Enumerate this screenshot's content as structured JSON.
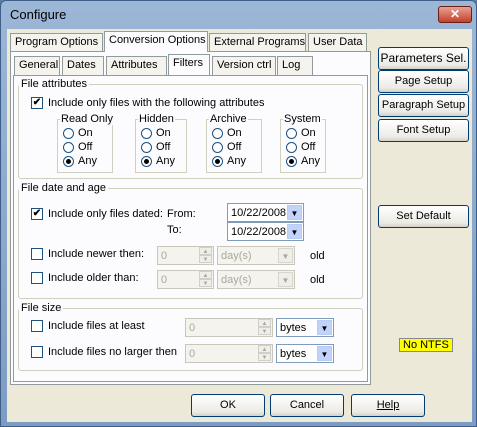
{
  "window": {
    "title": "Configure",
    "close_glyph": "✕"
  },
  "top_tabs": [
    "Program Options",
    "Conversion Options",
    "External Programs",
    "User Data"
  ],
  "sub_tabs": [
    "General",
    "Dates",
    "Attributes",
    "Filters",
    "Version ctrl",
    "Log"
  ],
  "file_attributes": {
    "title": "File attributes",
    "include_label": "Include only files with the following attributes",
    "include_checked": true,
    "groups": [
      {
        "title": "Read Only",
        "options": [
          "On",
          "Off",
          "Any"
        ],
        "selected": "Any"
      },
      {
        "title": "Hidden",
        "options": [
          "On",
          "Off",
          "Any"
        ],
        "selected": "Any"
      },
      {
        "title": "Archive",
        "options": [
          "On",
          "Off",
          "Any"
        ],
        "selected": "Any"
      },
      {
        "title": "System",
        "options": [
          "On",
          "Off",
          "Any"
        ],
        "selected": "Any"
      }
    ]
  },
  "file_date": {
    "title": "File date and age",
    "include_dated_label": "Include only files dated:",
    "include_dated_checked": true,
    "from_label": "From:",
    "from_value": "10/22/2008",
    "to_label": "To:",
    "to_value": "10/22/2008",
    "newer_label": "Include newer then:",
    "newer_value": "0",
    "newer_unit": "day(s)",
    "older_label": "Include older than:",
    "older_value": "0",
    "older_unit": "day(s)",
    "old_label": "old"
  },
  "file_size": {
    "title": "File size",
    "at_least_label": "Include files at least",
    "at_least_value": "0",
    "at_least_unit": "bytes",
    "no_larger_label": "Include files no larger then",
    "no_larger_value": "0",
    "no_larger_unit": "bytes"
  },
  "side_buttons": {
    "parameters": "Parameters Sel.",
    "page_setup": "Page Setup",
    "paragraph_setup": "Paragraph Setup",
    "font_setup": "Font Setup",
    "set_default": "Set Default"
  },
  "no_ntfs": "No NTFS",
  "bottom_buttons": {
    "ok": "OK",
    "cancel": "Cancel",
    "help": "Help"
  },
  "icons": {
    "check": "✔",
    "down": "▼",
    "up": "▲"
  },
  "colors": {
    "no_ntfs_bg": "#ffff00",
    "title_bar": "#9cb6d6"
  }
}
